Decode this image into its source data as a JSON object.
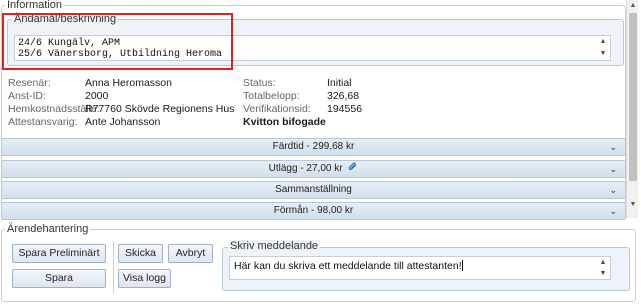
{
  "information": {
    "legend": "Information",
    "purpose": {
      "legend": "Ändamål/beskrivning",
      "lines": [
        "24/6 Kungälv, APM",
        "25/6 Vänersborg, Utbildning Heroma"
      ]
    },
    "left_fields": [
      {
        "label": "Resenär:",
        "value": "Anna Heromasson"
      },
      {
        "label": "Anst-ID:",
        "value": "2000"
      },
      {
        "label": "Hemkostnadsställe:",
        "value": "R77760 Skövde Regionens Hus"
      },
      {
        "label": "Attestansvarig:",
        "value": "Ante Johansson"
      }
    ],
    "right_fields": [
      {
        "label": "Status:",
        "value": "Initial"
      },
      {
        "label": "Totalbelopp:",
        "value": "326,68"
      },
      {
        "label": "Verifikationsid:",
        "value": "194556"
      }
    ],
    "receipts_note": "Kvitton bifogade"
  },
  "sections": [
    {
      "label": "Färdtid - 299,68 kr",
      "icon": "chevron-down-icon"
    },
    {
      "label": "Utlägg - 27,00 kr",
      "icon": "paperclip-icon"
    },
    {
      "label": "Sammanställning",
      "icon": "chevron-down-icon"
    },
    {
      "label": "Förmån - 98,00 kr",
      "icon": "chevron-down-icon"
    }
  ],
  "case_handling": {
    "legend": "Ärendehantering",
    "buttons": {
      "save_preliminary": "Spara Preliminärt",
      "save": "Spara",
      "send": "Skicka",
      "cancel": "Avbryt",
      "show_log": "Visa logg"
    },
    "message": {
      "legend": "Skriv meddelande",
      "value": "Här kan du skriva ett meddelande till attestanten!"
    }
  },
  "colors": {
    "highlight_border": "#e31f1f",
    "bar_fill": "#dbe6f2",
    "panel_fill": "#eef3f9"
  }
}
